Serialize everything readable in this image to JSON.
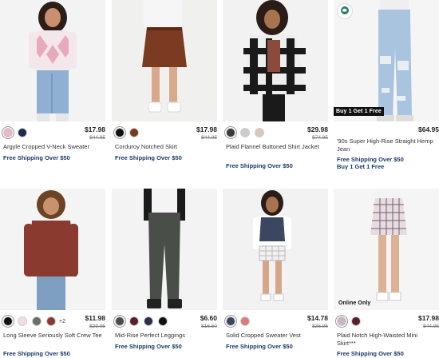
{
  "products": [
    {
      "name": "Argyle Cropped V-Neck Sweater",
      "price": "$17.98",
      "original_price": "$44.95",
      "shipping": "Free Shipping Over $50",
      "swatches": [
        "#e9b7c6",
        "#1f2a4a"
      ],
      "more_colors": "",
      "badge": ""
    },
    {
      "name": "Corduroy Notched Skirt",
      "price": "$17.98",
      "original_price": "$44.95",
      "shipping": "Free Shipping Over $50",
      "swatches": [
        "#111111",
        "#7a3a22"
      ],
      "more_colors": "",
      "badge": ""
    },
    {
      "name": "Plaid Flannel Buttoned Shirt Jacket",
      "price": "$29.98",
      "original_price": "$74.95",
      "shipping": "Free Shipping Over $50",
      "swatches": [
        "#3a3a3a",
        "#cccccc",
        "#d8c8b8"
      ],
      "more_colors": "",
      "badge": ""
    },
    {
      "name": "'90s Super High-Rise Straight Hemp Jean",
      "price": "$64.95",
      "original_price": "",
      "shipping": "Free Shipping Over $50",
      "promo": "Buy 1 Get 1 Free",
      "swatches": [],
      "more_colors": "",
      "badge": "Buy 1 Get 1 Free"
    },
    {
      "name": "Long Sleeve Seriously Soft Crew Tee",
      "price": "$11.98",
      "original_price": "$29.95",
      "shipping": "Free Shipping Over $50",
      "swatches": [
        "#111111",
        "#f2dede",
        "#6b6f5f",
        "#8a3a2e"
      ],
      "more_colors": "+2",
      "badge": ""
    },
    {
      "name": "Mid-Rise Perfect Leggings",
      "price": "$6.60",
      "original_price": "$16.50",
      "shipping": "Free Shipping Over $50",
      "swatches": [
        "#4a4e49",
        "#5a1f2a",
        "#2a2f45",
        "#111111"
      ],
      "more_colors": "",
      "badge": ""
    },
    {
      "name": "Solid Cropped Sweater Vest",
      "price": "$14.78",
      "original_price": "$36.95",
      "shipping": "Free Shipping Over $50",
      "swatches": [
        "#3b4760",
        "#e07a7a"
      ],
      "more_colors": "",
      "badge": ""
    },
    {
      "name": "Plaid Notch High-Waisted Mini Skirt***",
      "price": "$17.98",
      "original_price": "$44.95",
      "shipping": "Free Shipping Over $50",
      "swatches": [
        "#c9b6c4",
        "#5a1f2a"
      ],
      "more_colors": "",
      "badge": "Online Only"
    }
  ]
}
